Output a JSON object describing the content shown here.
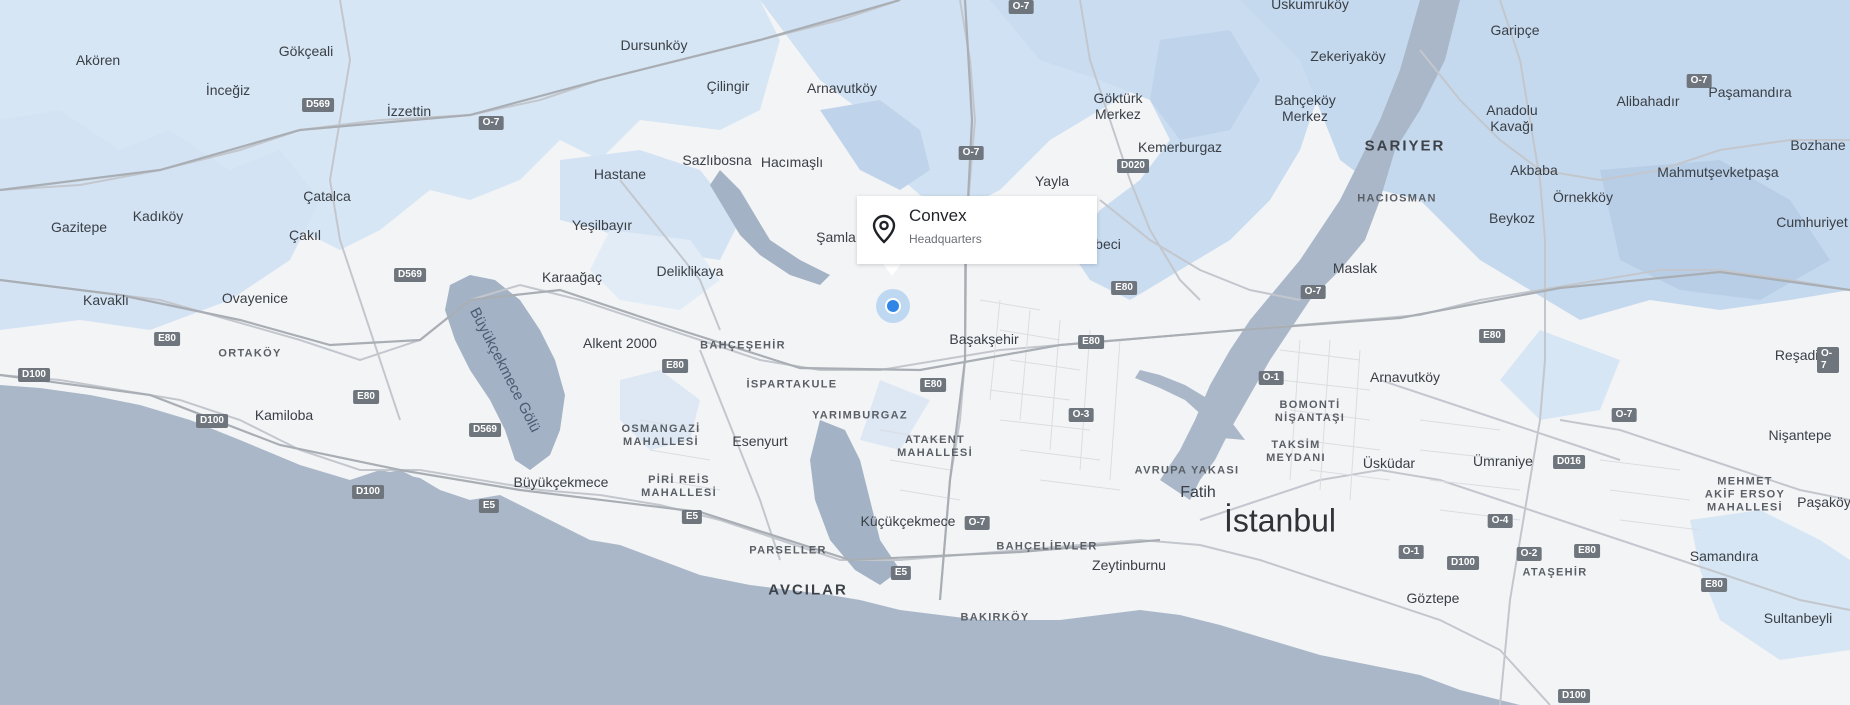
{
  "popup": {
    "title": "Convex",
    "subtitle": "Headquarters",
    "icon": "map-pin-icon"
  },
  "colors": {
    "sea": "#a9b7c8",
    "land": "#f3f4f6",
    "forest": "#cfe1f2",
    "forest_dark": "#b6cfe6",
    "road": "#c4c8ce",
    "marker": "#2f86e6"
  },
  "labels": {
    "uskumruk": "Uskumruköy",
    "garipce": "Garipçe",
    "akoren": "Akören",
    "gokceali": "Gökçeali",
    "dursunkoy": "Dursunköy",
    "zekeriyakoy": "Zekeriyaköy",
    "pasamandira": "Paşamandıra",
    "inceğiz": "İnceğiz",
    "izzettin": "İzzettin",
    "cilingir": "Çilingir",
    "arnavutkoy1": "Arnavutköy",
    "gokturk": "Göktürk\nMerkez",
    "bahcekoy": "Bahçeköy\nMerkez",
    "anadolu": "Anadolu\nKavağı",
    "alibahadir": "Alibahadır",
    "sariyer": "SARIYER",
    "bozhane": "Bozhane",
    "kemerburgaz": "Kemerburgaz",
    "sazlibosna": "Sazlıbosna",
    "hacimasli": "Hacımaşlı",
    "hastane": "Hastane",
    "akbaba": "Akbaba",
    "mahmutsevket": "Mahmutşevketpaşa",
    "catalca": "Çatalca",
    "yayla": "Yayla",
    "hacıosman": "HACIOSMAN",
    "ornekkoy": "Örnekköy",
    "gazitepe": "Gazitepe",
    "kadikoy": "Kadıköy",
    "yesilbayir": "Yeşilbayır",
    "beykoz": "Beykoz",
    "cumhuriyet": "Cumhuriyet",
    "cakil": "Çakıl",
    "samla": "Şamla",
    "ebeci": "beci",
    "deliklikaya": "Deliklikaya",
    "maslak": "Maslak",
    "karaagac": "Karaağaç",
    "kavakli": "Kavaklı",
    "ovayenice": "Ovayenice",
    "basaksehir": "Başakşehir",
    "alkent": "Alkent 2000",
    "bahcesehir": "BAHÇEŞEHİR",
    "ortakoy": "ORTAKÖY",
    "resadiye": "Reşadiye",
    "arnavutkoy2": "Arnavutköy",
    "ispartakule": "İSPARTAKULE",
    "bomonti": "BOMONTİ\nNİŞANTAŞI",
    "yarimburgaz": "YARIMBURGAZ",
    "kamiloba": "Kamiloba",
    "nisantepe": "Nişantepe",
    "osmangazi": "OSMANGAZİ\nMAHALLESİ",
    "esenyurt": "Esenyurt",
    "atakent": "ATAKENT\nMAHALLESİ",
    "taksim": "TAKSİM\nMEYDANI",
    "uskudar": "Üsküdar",
    "umraniye": "Ümraniye",
    "avrupa": "AVRUPA YAKASI",
    "buyukcekmece": "Büyükçekmece",
    "pirireis": "PİRİ REİS\nMAHALLESİ",
    "mehmet": "MEHMET\nAKİF ERSOY\nMAHALLESİ",
    "fatih": "Fatih",
    "pasakoy": "Paşaköy",
    "istanbul": "İstanbul",
    "kucukcekmece": "Küçükçekmece",
    "parseller": "PARSELLER",
    "bahcelievler": "BAHÇELİEVLER",
    "atasehir": "ATAŞEHİR",
    "samandira": "Samandıra",
    "zeytinburnu": "Zeytinburnu",
    "avcilar": "AVCILAR",
    "goztepe": "Göztepe",
    "sultanbeyli": "Sultanbeyli",
    "bakirkoy": "BAKIRKÖY",
    "buyukcekmece_golu": "Büyükçekmece Gölü",
    "uskumruk_top": "Uskumruköy",
    "top_cut": "ntepe"
  },
  "shields": [
    "O-7",
    "D569",
    "O-7",
    "O-7",
    "D020",
    "O-7",
    "D569",
    "E80",
    "O-7",
    "E80",
    "E80",
    "E80",
    "E80",
    "D100",
    "E80",
    "D100",
    "E80",
    "O-1",
    "O-3",
    "O-7",
    "D569",
    "D016",
    "D100",
    "E5",
    "O-4",
    "E5",
    "O-7",
    "O-1",
    "O-2",
    "E80",
    "E5",
    "D100",
    "E80",
    "D100",
    "O-7"
  ]
}
